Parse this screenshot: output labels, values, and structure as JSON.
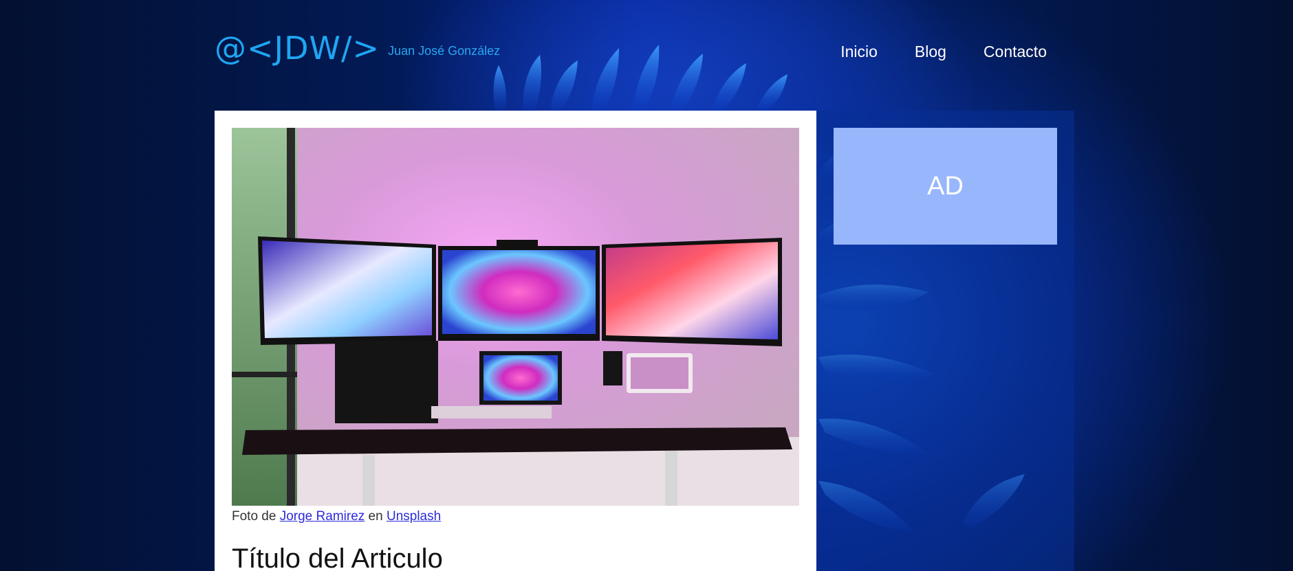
{
  "site": {
    "logo": "@<JDW/>",
    "author": "Juan José González"
  },
  "nav": {
    "items": [
      {
        "label": "Inicio"
      },
      {
        "label": "Blog"
      },
      {
        "label": "Contacto"
      }
    ]
  },
  "article": {
    "image_description_icon": "desk-setup-photo",
    "caption": {
      "prefix": "Foto de ",
      "photographer": "Jorge Ramirez",
      "middle": " en ",
      "source": "Unsplash"
    },
    "title": "Título del Articulo"
  },
  "sidebar": {
    "ad_label": "AD"
  },
  "colors": {
    "logo": "#1fa6f2",
    "ad_background": "#98b6fb",
    "link": "#2b2bd9"
  }
}
